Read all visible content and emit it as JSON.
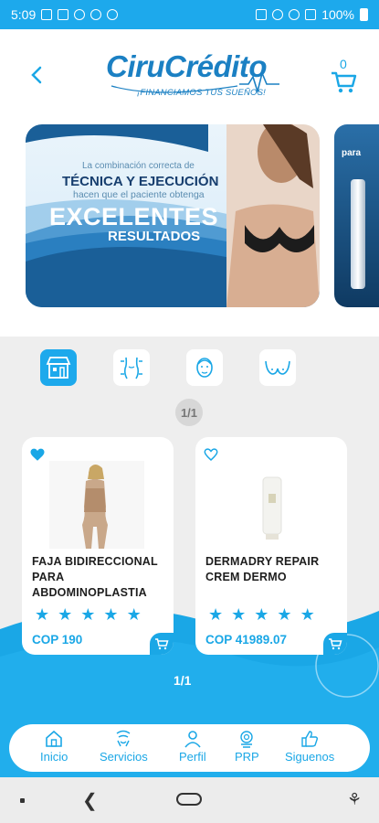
{
  "status_bar": {
    "time": "5:09",
    "battery": "100%"
  },
  "header": {
    "brand": "CiruCrédito",
    "tagline": "¡FINANCIAMOS TUS SUEÑOS!",
    "cart_count": "0"
  },
  "banner": {
    "line1": "La combinación correcta de",
    "line2": "TÉCNICA Y EJECUCIÓN",
    "line3": "hacen que el paciente obtenga",
    "line4": "EXCELENTES",
    "line5": "RESULTADOS",
    "next_partial": "para"
  },
  "categories": [
    {
      "icon": "store-icon",
      "active": true
    },
    {
      "icon": "body-shape-icon",
      "active": false
    },
    {
      "icon": "face-icon",
      "active": false
    },
    {
      "icon": "bust-icon",
      "active": false
    }
  ],
  "pager_top": "1/1",
  "products": [
    {
      "name": "FAJA BIDIRECCIONAL PARA ABDOMINOPLASTIA",
      "price": "COP 190",
      "rating": 5,
      "favorite": true
    },
    {
      "name": "DERMADRY REPAIR CREM DERMO",
      "price": "COP 41989.07",
      "rating": 5,
      "favorite": false
    }
  ],
  "pager_bottom": "1/1",
  "nav": {
    "inicio": "Inicio",
    "servicios": "Servicios",
    "perfil": "Perfil",
    "prp": "PRP",
    "siguenos": "Siguenos"
  },
  "colors": {
    "accent": "#1aa7e6",
    "brand": "#1b80c3",
    "status_bar": "#1da9ec"
  }
}
